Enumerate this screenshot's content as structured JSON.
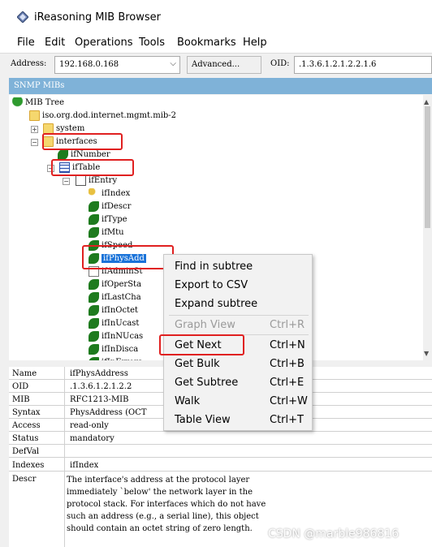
{
  "window": {
    "title": "iReasoning MIB Browser",
    "icon": "app-diamond-icon"
  },
  "menu": [
    "File",
    "Edit",
    "Operations",
    "Tools",
    "Bookmarks",
    "Help"
  ],
  "toolbar": {
    "address_label": "Address:",
    "address_value": "192.168.0.168",
    "advanced_label": "Advanced...",
    "oid_label": "OID:",
    "oid_value": ".1.3.6.1.2.1.2.2.1.6"
  },
  "panel_header": "SNMP MIBs",
  "tree": {
    "root": "MIB Tree",
    "mib2": "iso.org.dod.internet.mgmt.mib-2",
    "system": "system",
    "interfaces": "interfaces",
    "ifNumber": "ifNumber",
    "ifTable": "ifTable",
    "ifEntry": "ifEntry",
    "entries": [
      "ifIndex",
      "ifDescr",
      "ifType",
      "ifMtu",
      "ifSpeed",
      "ifPhysAdd",
      "ifAdminSt",
      "ifOperSta",
      "ifLastCha",
      "ifInOctet",
      "ifInUcast",
      "ifInNUcas",
      "ifInDisca",
      "ifInErrors"
    ]
  },
  "properties": {
    "rows": [
      {
        "key": "Name",
        "value": "ifPhysAddress"
      },
      {
        "key": "OID",
        "value": ".1.3.6.1.2.1.2.2"
      },
      {
        "key": "MIB",
        "value": "RFC1213-MIB"
      },
      {
        "key": "Syntax",
        "value": "PhysAddress (OCT"
      },
      {
        "key": "Access",
        "value": "read-only"
      },
      {
        "key": "Status",
        "value": "mandatory"
      },
      {
        "key": "DefVal",
        "value": ""
      },
      {
        "key": "Indexes",
        "value": "ifIndex"
      },
      {
        "key": "Descr",
        "value": ""
      }
    ],
    "descr_text": "The interface's address at the protocol layer\nimmediately `below' the network layer in the\nprotocol stack.  For interfaces which do not have\nsuch an address (e.g., a serial line), this object\nshould contain an octet string of zero length."
  },
  "context_menu": {
    "items": [
      {
        "label": "Find in subtree",
        "shortcut": ""
      },
      {
        "label": "Export to CSV",
        "shortcut": ""
      },
      {
        "label": "Expand subtree",
        "shortcut": ""
      },
      {
        "label": "Graph View",
        "shortcut": "Ctrl+R",
        "disabled": true
      },
      {
        "label": "Get Next",
        "shortcut": "Ctrl+N"
      },
      {
        "label": "Get Bulk",
        "shortcut": "Ctrl+B"
      },
      {
        "label": "Get Subtree",
        "shortcut": "Ctrl+E"
      },
      {
        "label": "Walk",
        "shortcut": "Ctrl+W"
      },
      {
        "label": "Table View",
        "shortcut": "Ctrl+T"
      }
    ]
  },
  "watermark": "CSDN @marble986816",
  "colors": {
    "panel_header": "#7fb2d8",
    "selection": "#1a73d9",
    "highlight_box": "#e02020"
  }
}
